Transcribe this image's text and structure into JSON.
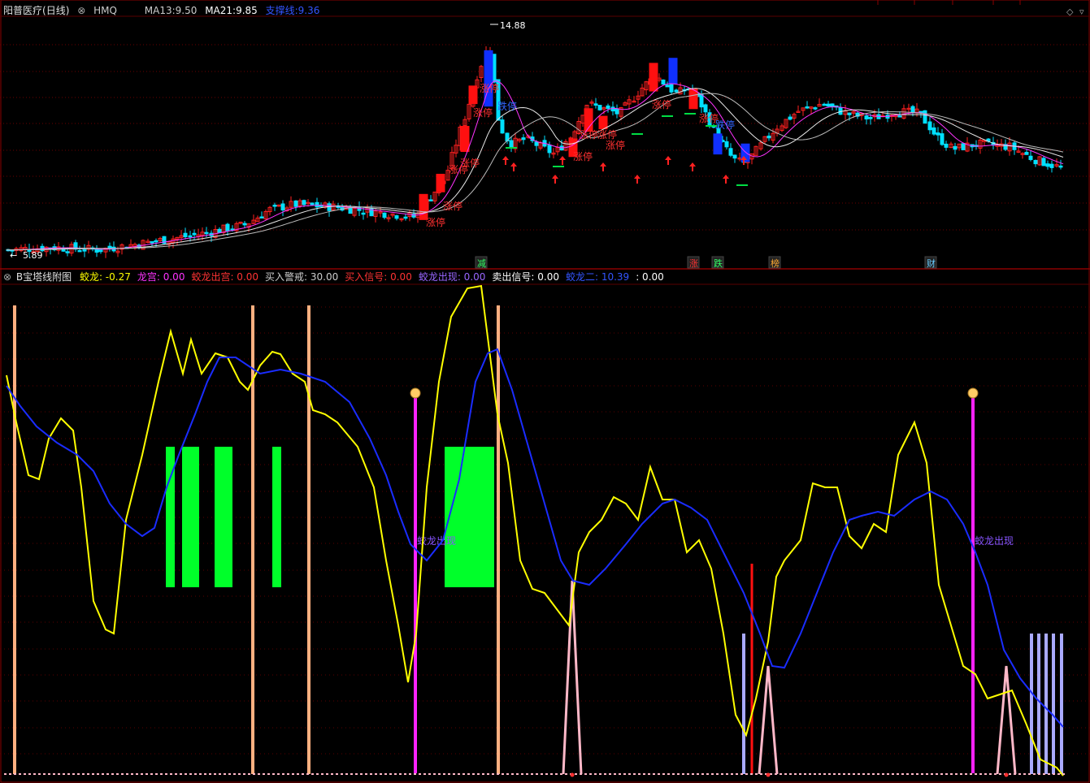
{
  "top": {
    "stock_name": "阳普医疗",
    "period": "(日线)",
    "code": "HMQ",
    "ma13_label": "MA13:",
    "ma13_value": "9.50",
    "ma21_label": "MA21:",
    "ma21_value": "9.85",
    "support_label": "支撑线:",
    "support_value": "9.36",
    "high_label": "14.88",
    "low_label": "5.89",
    "limit_up": "涨停",
    "limit_down": "跌停",
    "tags": [
      "减",
      "涨",
      "跌",
      "榜",
      "财"
    ]
  },
  "bottom": {
    "indicator_name": "B宝塔线附图",
    "items": [
      {
        "label": "蛟龙:",
        "value": "-0.27",
        "color": "#ffff00"
      },
      {
        "label": "龙宫:",
        "value": "0.00",
        "color": "#ff33ff"
      },
      {
        "label": "蛟龙出宫:",
        "value": "0.00",
        "color": "#ff3333"
      },
      {
        "label": "买入警戒:",
        "value": "30.00",
        "color": "#cccccc"
      },
      {
        "label": "买入信号:",
        "value": "0.00",
        "color": "#ff3333"
      },
      {
        "label": "蛟龙出现:",
        "value": "0.00",
        "color": "#9966ff"
      },
      {
        "label": "卖出信号:",
        "value": "0.00",
        "color": "#ffffff"
      },
      {
        "label": "蛟龙二:",
        "value": "10.39",
        "color": "#3355ff"
      },
      {
        "label": ":",
        "value": "0.00",
        "color": "#ffffff"
      }
    ],
    "signal_text": "蛟龙出现"
  },
  "colors": {
    "up": "#ff2020",
    "down": "#00e0ff",
    "ma_white": "#e8e8e8",
    "ma_magenta": "#ff33ff",
    "yellow": "#ffff00",
    "blue": "#1a2cff",
    "orange": "#ffb080",
    "green": "#00ff2a",
    "pink": "#ffb8c8",
    "lavender": "#aaaaff"
  }
}
